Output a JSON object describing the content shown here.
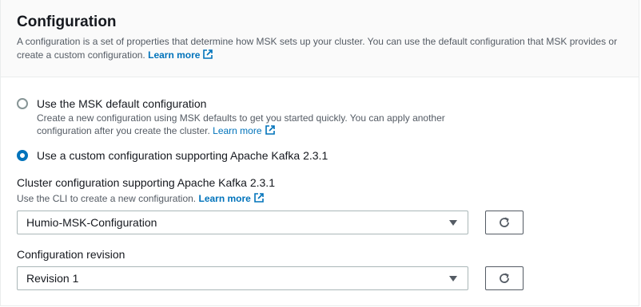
{
  "section": {
    "title": "Configuration",
    "description": "A configuration is a set of properties that determine how MSK sets up your cluster. You can use the default configuration that MSK provides or create a custom configuration.",
    "learn_more": "Learn more"
  },
  "options": [
    {
      "label": "Use the MSK default configuration",
      "description": "Create a new configuration using MSK defaults to get you started quickly. You can apply another configuration after you create the cluster.",
      "learn_more": "Learn more",
      "selected": false
    },
    {
      "label": "Use a custom configuration supporting Apache Kafka 2.3.1",
      "selected": true
    }
  ],
  "cluster_config": {
    "label": "Cluster configuration supporting Apache Kafka 2.3.1",
    "description": "Use the CLI to create a new configuration.",
    "learn_more": "Learn more",
    "selected_value": "Humio-MSK-Configuration"
  },
  "revision": {
    "label": "Configuration revision",
    "selected_value": "Revision 1"
  },
  "colors": {
    "accent": "#0073bb",
    "header_bg": "#fafafa",
    "text": "#16191f",
    "secondary_text": "#545b64"
  },
  "icons": [
    "external-link-icon",
    "refresh-icon",
    "caret-down-icon"
  ]
}
